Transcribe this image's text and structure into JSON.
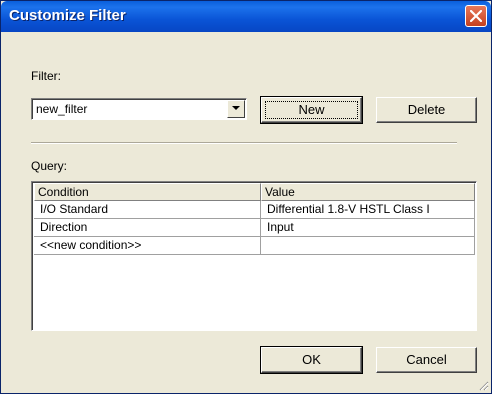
{
  "window": {
    "title": "Customize Filter",
    "close_icon": "close-icon"
  },
  "filter": {
    "label": "Filter:",
    "selected": "new_filter",
    "new_label": "New",
    "delete_label": "Delete"
  },
  "query": {
    "label": "Query:",
    "columns": [
      "Condition",
      "Value"
    ],
    "rows": [
      {
        "condition": "I/O Standard",
        "value": "Differential 1.8-V HSTL Class I"
      },
      {
        "condition": "Direction",
        "value": "Input"
      },
      {
        "condition": "<<new condition>>",
        "value": ""
      }
    ]
  },
  "footer": {
    "ok_label": "OK",
    "cancel_label": "Cancel"
  },
  "colors": {
    "titlebar": "#0a54d6",
    "dialog_bg": "#ece9d8",
    "close_button": "#c4401f"
  }
}
